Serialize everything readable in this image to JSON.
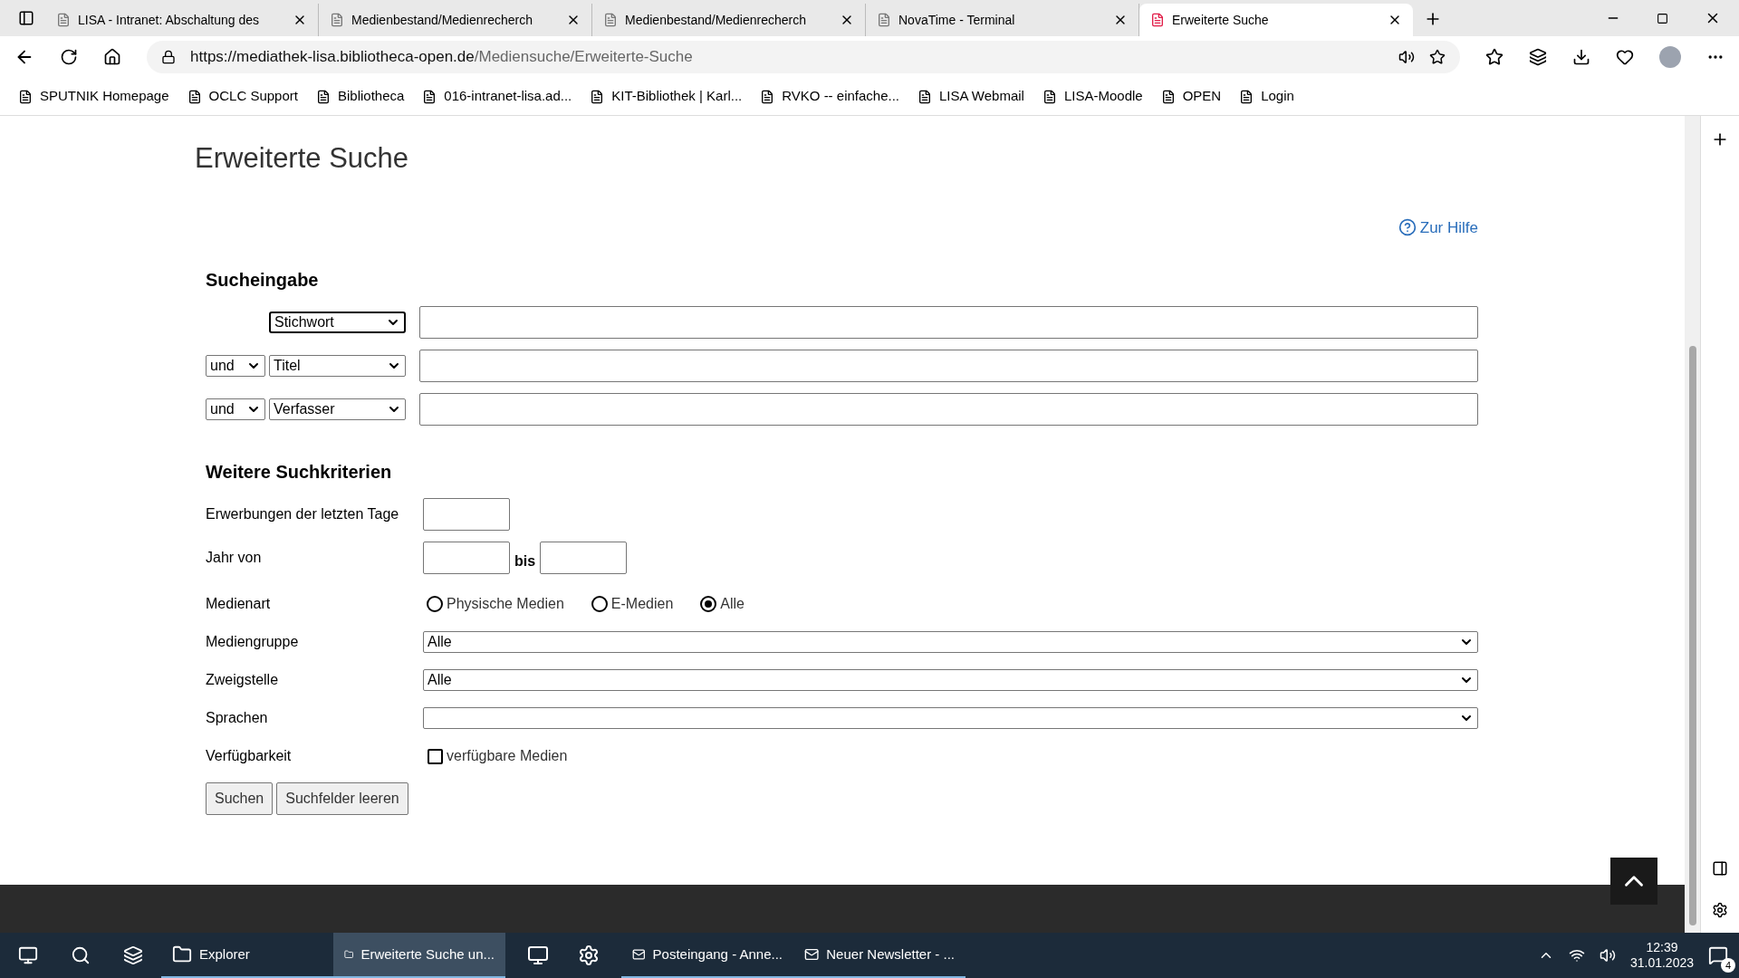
{
  "browser": {
    "tabs": [
      {
        "title": "LISA - Intranet: Abschaltung des",
        "selected": false
      },
      {
        "title": "Medienbestand/Medienrecherch",
        "selected": false
      },
      {
        "title": "Medienbestand/Medienrecherch",
        "selected": false
      },
      {
        "title": "NovaTime - Terminal",
        "selected": false
      },
      {
        "title": "Erweiterte Suche",
        "selected": true
      }
    ],
    "url_host": "https://mediathek-lisa.bibliotheca-open.de",
    "url_path": "/Mediensuche/Erweiterte-Suche",
    "bookmarks": [
      "SPUTNIK Homepage",
      "OCLC Support",
      "Bibliotheca",
      "016-intranet-lisa.ad...",
      "KIT-Bibliothek | Karl...",
      "RVKO -- einfache...",
      "LISA Webmail",
      "LISA-Moodle",
      "OPEN",
      "Login"
    ]
  },
  "page": {
    "title": "Erweiterte Suche",
    "help_link": "Zur Hilfe",
    "search_heading": "Sucheingabe",
    "search_rows": [
      {
        "operator": null,
        "field": "Stichwort",
        "focused": true
      },
      {
        "operator": "und",
        "field": "Titel",
        "focused": false
      },
      {
        "operator": "und",
        "field": "Verfasser",
        "focused": false
      }
    ],
    "criteria_heading": "Weitere Suchkriterien",
    "acquisitions_label": "Erwerbungen der letzten Tage",
    "year_label": "Jahr von",
    "year_to": "bis",
    "media_type_label": "Medienart",
    "media_types": [
      {
        "label": "Physische Medien",
        "selected": false
      },
      {
        "label": "E-Medien",
        "selected": false
      },
      {
        "label": "Alle",
        "selected": true
      }
    ],
    "selects": [
      {
        "label": "Mediengruppe",
        "value": "Alle"
      },
      {
        "label": "Zweigstelle",
        "value": "Alle"
      },
      {
        "label": "Sprachen"
      }
    ],
    "availability_label": "Verfügbarkeit",
    "availability_option": {
      "label": "verfügbare Medien",
      "checked": false
    },
    "buttons": [
      "Suchen",
      "Suchfelder leeren"
    ]
  },
  "taskbar": {
    "apps": [
      {
        "label": "Explorer",
        "active": false
      },
      {
        "label": "Erweiterte Suche un...",
        "active": true
      },
      {
        "label": "Posteingang - Anne...",
        "active": false
      },
      {
        "label": "Neuer Newsletter - ...",
        "active": false
      }
    ],
    "time": "12:39",
    "date": "31.01.2023",
    "notifications": "4"
  }
}
